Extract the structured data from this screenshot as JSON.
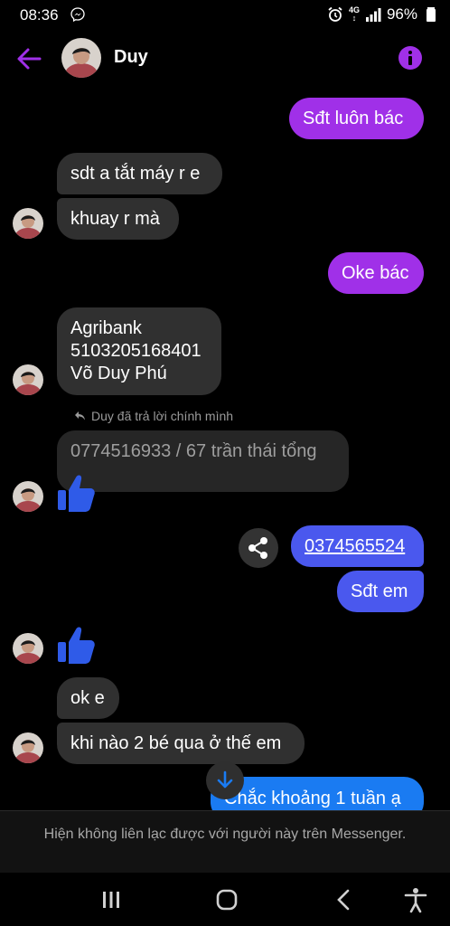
{
  "status_bar": {
    "time": "08:36",
    "network": "4G",
    "battery": "96%"
  },
  "header": {
    "contact_name": "Duy"
  },
  "messages": {
    "m1": "Sđt luôn bác",
    "m2": "sdt a tắt máy r e",
    "m3": "khuay r mà",
    "m4": "Oke bác",
    "m5": [
      "Agribank",
      "5103205168401",
      "Võ Duy Phú"
    ],
    "reply_note": "Duy đã trả lời chính mình",
    "m6": "0774516933 / 67 trần thái tổng",
    "m7": "0374565524",
    "m8": "Sđt em",
    "m9": "ok e",
    "m10": "khi nào 2 bé qua ở thế em",
    "m11": "Chắc khoảng 1 tuần ạ"
  },
  "notice": "Hiện không liên lạc được với người này trên Messenger.",
  "colors": {
    "accent_purple": "#a030e8",
    "bubble_blue": "#4a58ee",
    "like_blue": "#2f5be8",
    "incoming_bubble": "#303030"
  },
  "icons": [
    "messenger-icon",
    "alarm-icon",
    "signal-icon",
    "battery-icon",
    "back-arrow-icon",
    "info-icon",
    "reply-icon",
    "thumbs-up-icon",
    "share-icon",
    "arrow-down-icon",
    "recent-apps-icon",
    "home-icon",
    "back-nav-icon",
    "accessibility-icon"
  ]
}
